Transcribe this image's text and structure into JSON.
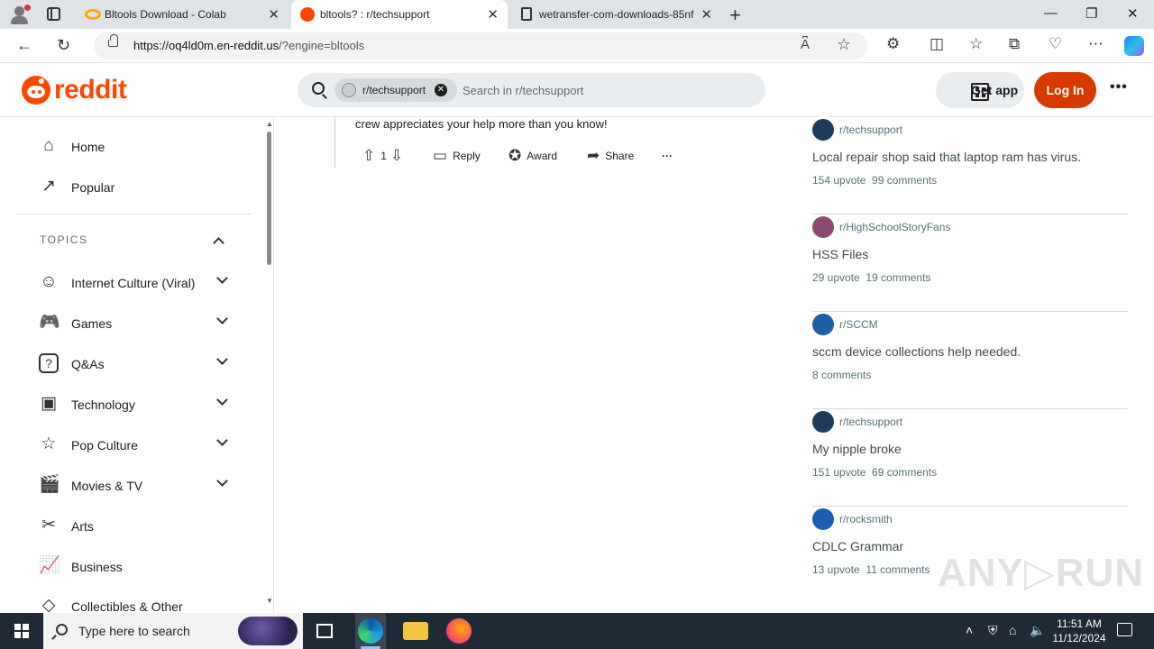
{
  "browser": {
    "tabs": [
      {
        "title": "Bltools Download - Colab",
        "close": "✕"
      },
      {
        "title": "bltools? : r/techsupport",
        "close": "✕"
      },
      {
        "title": "wetransfer-com-downloads-85nf",
        "close": "✕"
      }
    ],
    "new_tab": "+",
    "window": {
      "minimize": "—",
      "maximize": "❐",
      "close": "✕"
    },
    "url_host": "https://oq4ld0m.en-reddit.us",
    "url_path": "/?engine=bltools",
    "nav": {
      "back": "←",
      "reload": "↻"
    },
    "url_icons": {
      "read_aloud": "A͆",
      "favorite": "☆"
    },
    "toolbar_icons": {
      "extensions": "⚙",
      "split": "◫",
      "favorites": "☆",
      "collections": "⧉",
      "performance": "♡",
      "more": "⋯"
    }
  },
  "reddit": {
    "logo_text": "reddit",
    "search": {
      "chip": "r/techsupport",
      "chip_close": "✕",
      "placeholder": "Search in r/techsupport"
    },
    "get_app": "Get app",
    "login": "Log In",
    "more": "•••"
  },
  "sidebar": {
    "items": [
      {
        "label": "Home",
        "icon": "⌂"
      },
      {
        "label": "Popular",
        "icon": "↗"
      }
    ],
    "topics_label": "TOPICS",
    "topics": [
      {
        "label": "Internet Culture (Viral)",
        "icon": "☺"
      },
      {
        "label": "Games",
        "icon": "🎮"
      },
      {
        "label": "Q&As",
        "icon": "?"
      },
      {
        "label": "Technology",
        "icon": "▣"
      },
      {
        "label": "Pop Culture",
        "icon": "☆"
      },
      {
        "label": "Movies & TV",
        "icon": "🎬"
      },
      {
        "label": "Arts",
        "icon": "✂"
      },
      {
        "label": "Business",
        "icon": "📈"
      },
      {
        "label": "Collectibles & Other",
        "icon": "◇"
      }
    ]
  },
  "comment": {
    "text": "crew appreciates your help more than you know!",
    "votes": "1",
    "reply": "Reply",
    "award": "Award",
    "share": "Share",
    "more": "···"
  },
  "rail": {
    "posts": [
      {
        "sub": "r/techsupport",
        "title": "Local repair shop said that laptop ram has virus.",
        "meta": "154 upvote  99 comments",
        "avatar_color": "#1d3b5b"
      },
      {
        "sub": "r/HighSchoolStoryFans",
        "title": "HSS Files",
        "meta": "29 upvote  19 comments",
        "avatar_color": "#8a4b6e"
      },
      {
        "sub": "r/SCCM",
        "title": "sccm device collections help needed.",
        "meta": "8 comments",
        "avatar_color": "#1f5fa6"
      },
      {
        "sub": "r/techsupport",
        "title": "My nipple broke",
        "meta": "151 upvote  69 comments",
        "avatar_color": "#1d3b5b"
      },
      {
        "sub": "r/rocksmith",
        "title": "CDLC Grammar",
        "meta": "13 upvote  11 comments",
        "avatar_color": "#1c5fb0"
      }
    ]
  },
  "watermark": "ANY▷RUN",
  "taskbar": {
    "search_placeholder": "Type here to search",
    "time": "11:51 AM",
    "date": "11/12/2024"
  }
}
